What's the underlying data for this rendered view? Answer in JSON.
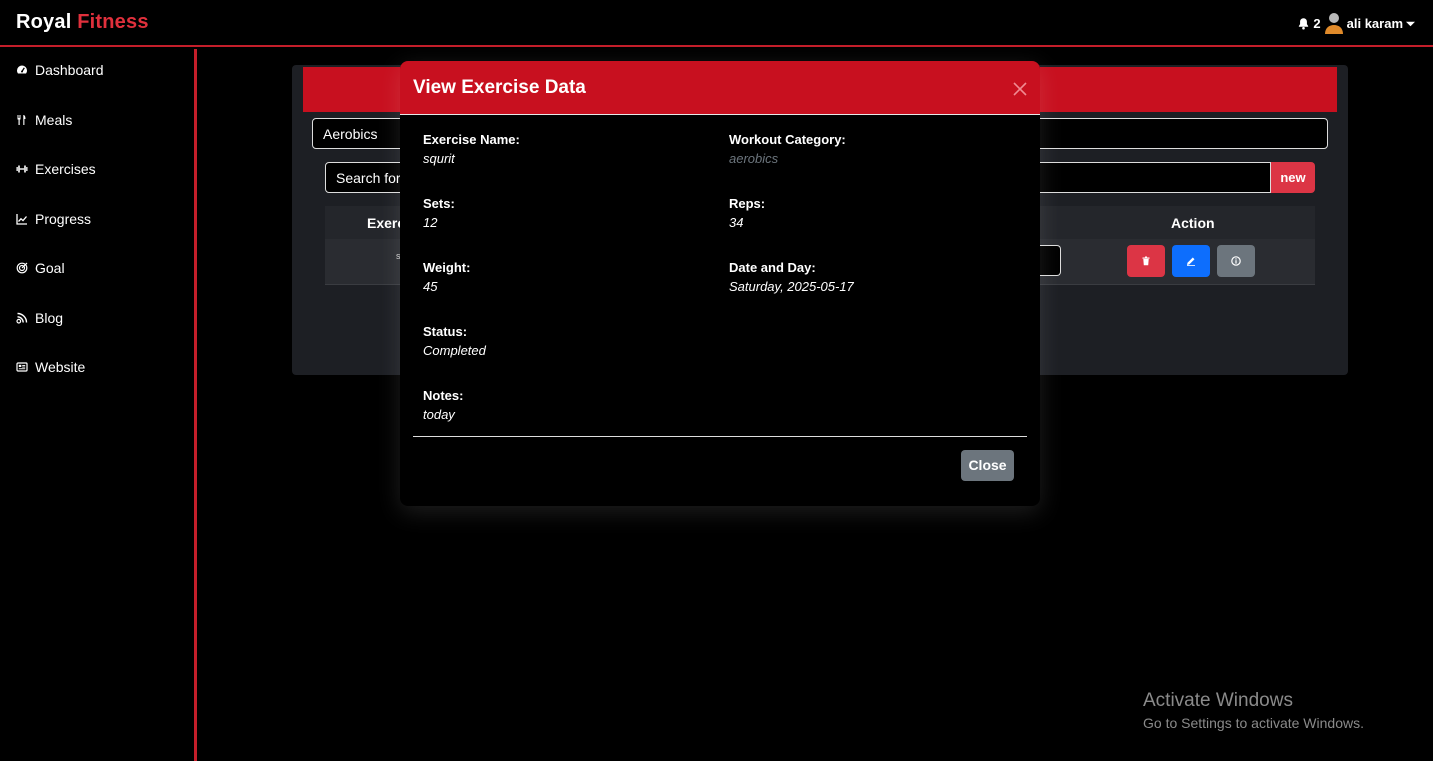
{
  "brand": {
    "part1": "Royal",
    "part2": "Fitness"
  },
  "navbar": {
    "notification_count": "2",
    "user_name": "ali karam"
  },
  "sidebar": {
    "items": [
      {
        "label": "Dashboard",
        "icon": "gauge-icon"
      },
      {
        "label": "Meals",
        "icon": "utensils-icon"
      },
      {
        "label": "Exercises",
        "icon": "dumbbell-icon"
      },
      {
        "label": "Progress",
        "icon": "chart-line-icon"
      },
      {
        "label": "Goal",
        "icon": "bullseye-icon"
      },
      {
        "label": "Blog",
        "icon": "blog-icon"
      },
      {
        "label": "Website",
        "icon": "newspaper-icon"
      }
    ]
  },
  "content": {
    "category_value": "Aerobics",
    "search_placeholder": "Search for",
    "new_button": "new",
    "table": {
      "col_exercise": "Exerc",
      "col_action": "Action",
      "row_text": "s"
    }
  },
  "modal": {
    "title": "View Exercise Data",
    "fields": {
      "exercise_name_label": "Exercise Name:",
      "exercise_name_value": "squrit",
      "category_label": "Workout Category:",
      "category_value": "aerobics",
      "sets_label": "Sets:",
      "sets_value": "12",
      "reps_label": "Reps:",
      "reps_value": "34",
      "weight_label": "Weight:",
      "weight_value": "45",
      "date_label": "Date and Day:",
      "date_value": "Saturday, 2025-05-17",
      "status_label": "Status:",
      "status_value": "Completed",
      "notes_label": "Notes:",
      "notes_value": "today"
    },
    "close_button": "Close"
  },
  "watermark": {
    "title": "Activate Windows",
    "subtitle": "Go to Settings to activate Windows."
  },
  "colors": {
    "accent": "#c8101f",
    "danger": "#dc3545",
    "primary": "#0d6efd",
    "secondary": "#6c757d"
  }
}
